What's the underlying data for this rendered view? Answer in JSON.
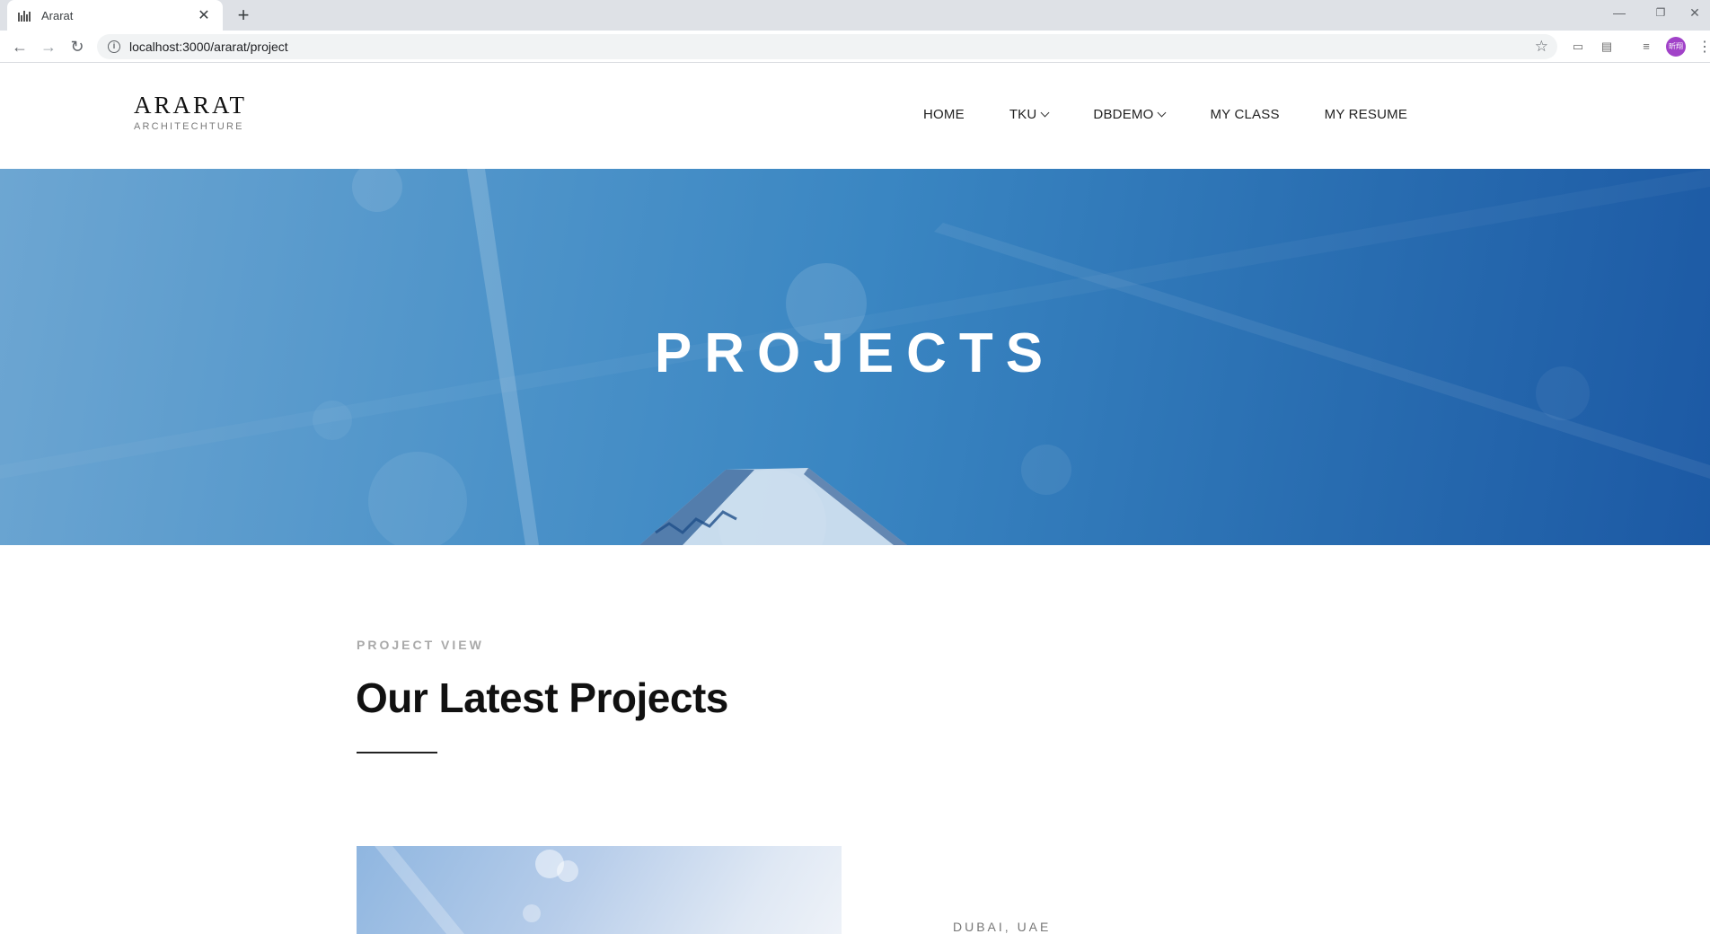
{
  "browser": {
    "tab_title": "Ararat",
    "tab_close": "✕",
    "new_tab": "+",
    "url": "localhost:3000/ararat/project",
    "profile_initials": "昕翔",
    "window_controls": {
      "minimize": "—",
      "restore": "❐",
      "close": "✕"
    }
  },
  "header": {
    "logo_title": "ARARAT",
    "logo_subtitle": "ARCHITECHTURE",
    "nav": [
      {
        "label": "HOME",
        "dropdown": false
      },
      {
        "label": "TKU",
        "dropdown": true
      },
      {
        "label": "DBDEMO",
        "dropdown": true
      },
      {
        "label": "MY CLASS",
        "dropdown": false
      },
      {
        "label": "MY RESUME",
        "dropdown": false
      }
    ]
  },
  "hero": {
    "title": "PROJECTS"
  },
  "section": {
    "eyebrow": "PROJECT VIEW",
    "title": "Our Latest Projects"
  },
  "project": {
    "location": "DUBAI, UAE"
  },
  "colors": {
    "hero_light": "#6da6d2",
    "hero_dark": "#1c59a4",
    "avatar": "#a142c8"
  }
}
